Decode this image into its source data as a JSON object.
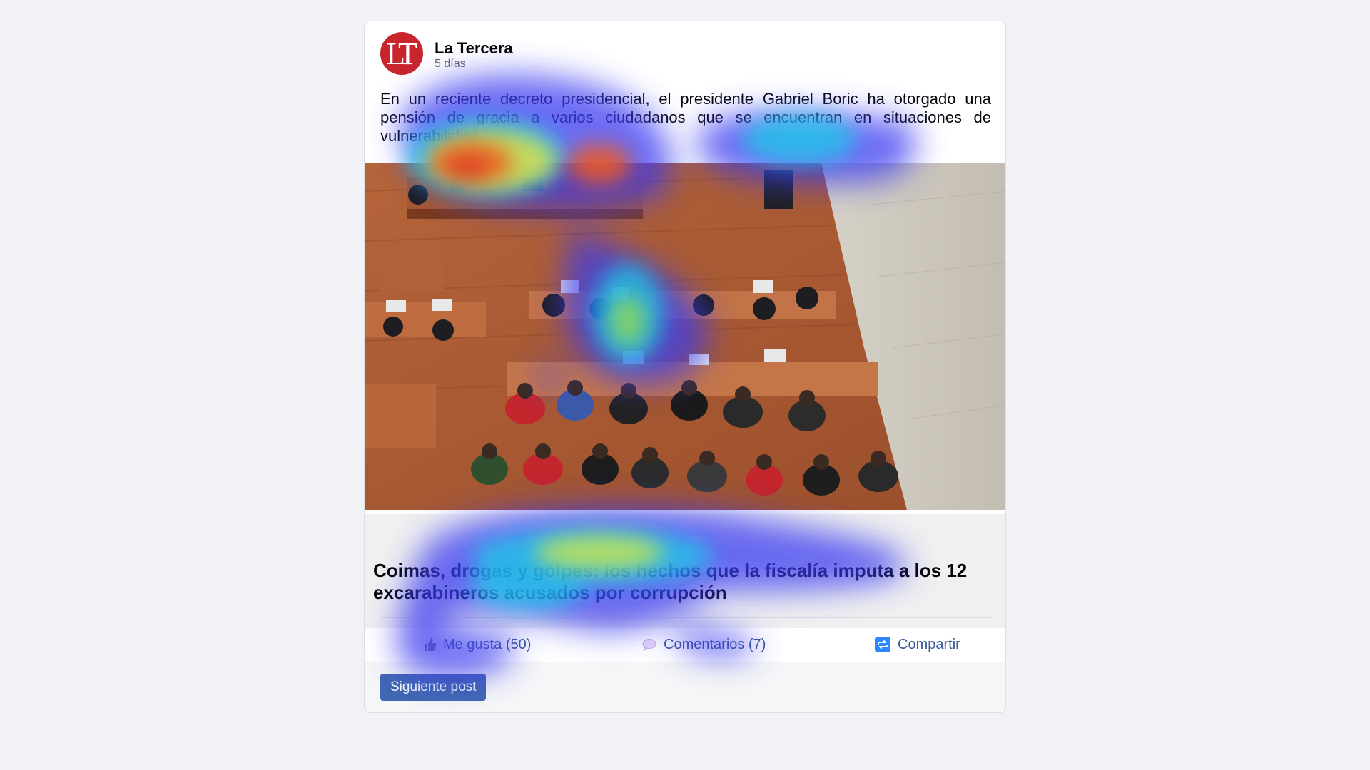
{
  "post": {
    "page_name": "La Tercera",
    "avatar_text": "LT",
    "timestamp": "5 días",
    "text": "En un reciente decreto presidencial, el presidente Gabriel Boric ha otorgado una pensión de gracia a varios ciudadanos que se encuentran en situaciones de vulnerabilidad.",
    "image_icon": "courtroom-photo",
    "link_title": "Coimas, drogas y golpes: los hechos que la fiscalía imputa a los 12 excarabineros acusados por corrupción"
  },
  "actions": {
    "like_label": "Me gusta (50)",
    "comment_label": "Comentarios (7)",
    "share_label": "Compartir"
  },
  "footer": {
    "next_label": "Siguiente post"
  },
  "colors": {
    "brand_red": "#c8252c",
    "link_blue": "#385898",
    "button_blue": "#4267b2",
    "background": "#f0f2f5"
  }
}
